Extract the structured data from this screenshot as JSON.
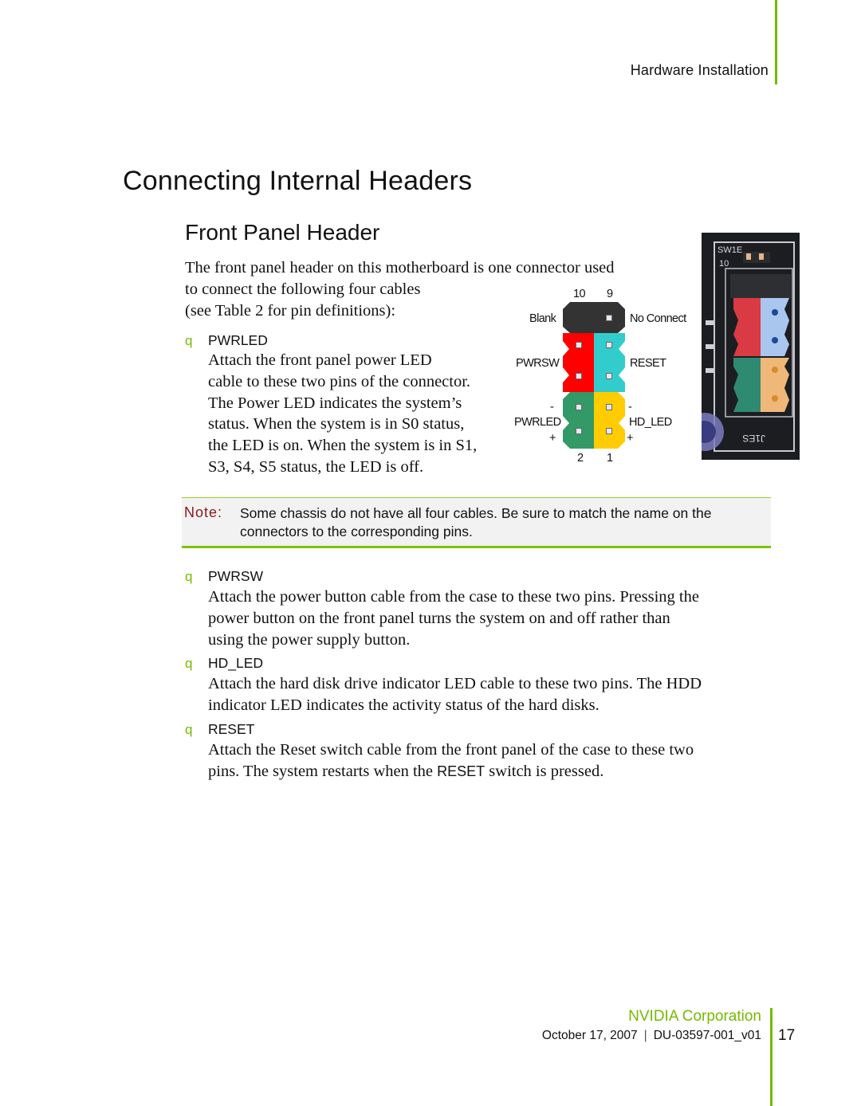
{
  "header": {
    "section": "Hardware Installation",
    "accent_color": "#76b900"
  },
  "title": "Connecting Internal Headers",
  "subtitle": "Front Panel Header",
  "intro": {
    "lines": [
      "The front panel header on this motherboard is one connector used",
      "to connect the following four cables",
      "(see Table 2 for pin definitions):"
    ]
  },
  "bullets": {
    "marker": "q",
    "pwrled": {
      "title": "PWRLED",
      "lines": [
        "Attach the front panel power LED",
        "cable to these two pins of the connector.",
        "The Power LED indicates the system’s",
        "status. When the system is in S0 status,",
        "the LED is on. When the system is in S1,",
        "S3, S4, S5 status, the LED is off."
      ]
    },
    "pwrsw": {
      "title": "PWRSW",
      "lines": [
        "Attach the power button cable from the case to these two pins. Pressing the",
        "power button on the front panel turns the system on and off rather than",
        "using the power supply button."
      ]
    },
    "hdled": {
      "title": "HD_LED",
      "lines": [
        "Attach the hard disk drive indicator LED cable to these two pins. The HDD",
        "indicator LED indicates the activity status of the hard disks."
      ]
    },
    "reset": {
      "title": "RESET",
      "line1": "Attach the Reset switch cable from the front panel of the case to these two",
      "line2_pre": "pins. The system restarts when the ",
      "line2_mono": "RESET",
      "line2_post": " switch is pressed."
    }
  },
  "diagram": {
    "top_pins": [
      "10",
      "9"
    ],
    "bottom_pins": [
      "2",
      "1"
    ],
    "labels": {
      "blank": "Blank",
      "no_connect": "No Connect",
      "pwrsw": "PWRSW",
      "reset": "RESET",
      "pwrled": "PWRLED",
      "hdled": "HD_LED",
      "minus": "-",
      "plus": "+"
    },
    "colors": {
      "blank": "#333333",
      "pwrsw": "#ff0000",
      "reset": "#33cccc",
      "pwrled": "#339966",
      "hdled": "#ffcc00"
    }
  },
  "photo": {
    "silk_top": "SW1E",
    "silk_mark": "10",
    "silk_bottom": "J1ES"
  },
  "note": {
    "label": "Note:",
    "lines": [
      "Some chassis do not have all four cables. Be sure to match the name on the",
      "connectors to the corresponding pins."
    ]
  },
  "footer": {
    "company": "NVIDIA Corporation",
    "date": "October 17, 2007",
    "separator": "|",
    "doc_id": "DU-03597-001_v01",
    "page_number": "17"
  }
}
